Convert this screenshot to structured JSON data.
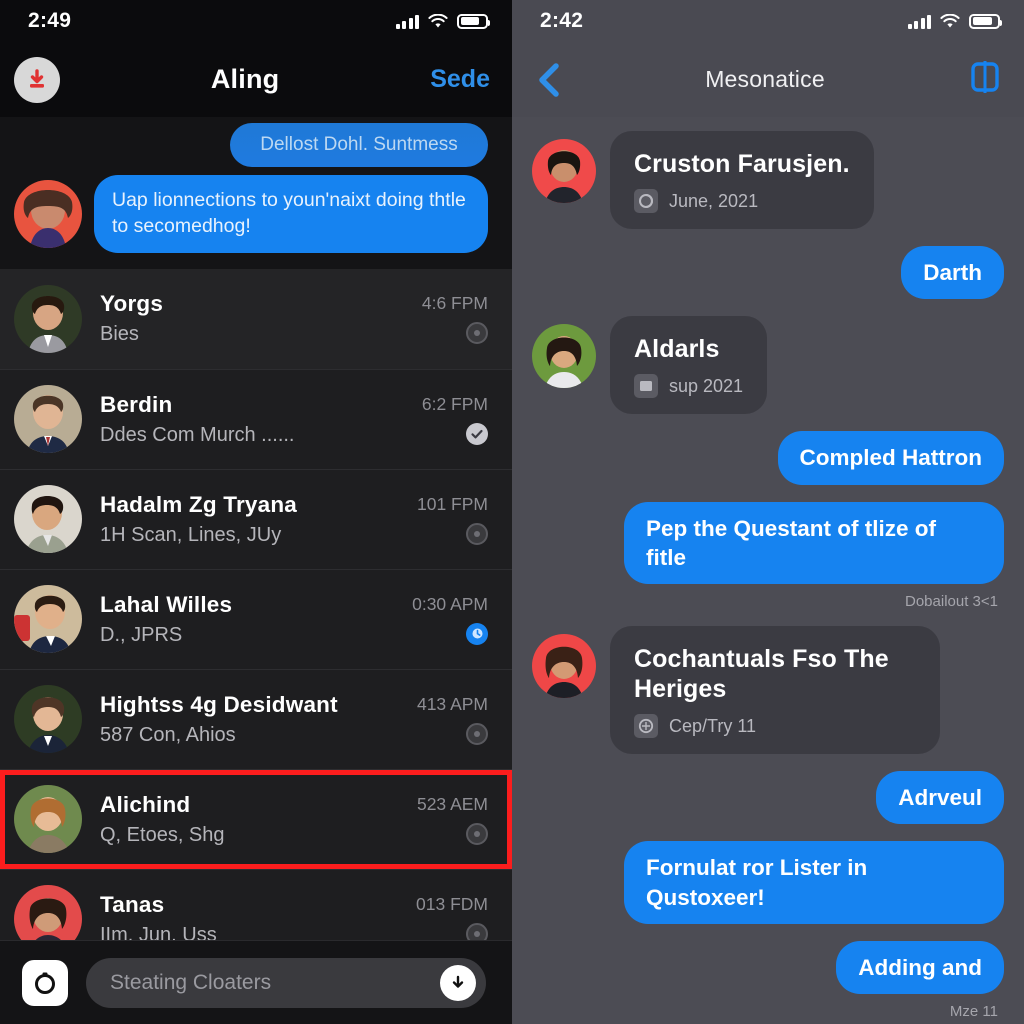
{
  "left": {
    "status": {
      "time": "2:49",
      "signal_icon": "cellular-bars-icon",
      "wifi_icon": "wifi-icon",
      "battery_icon": "battery-icon"
    },
    "nav": {
      "download_icon": "download-icon",
      "title": "Aling",
      "action_label": "Sede"
    },
    "preview": {
      "top_bubble": "Dellost Dohl. Suntmess",
      "main_bubble": "Uap lionnections to youn'naixt doing thtle to secomedhog!"
    },
    "rows": [
      {
        "name": "Yorgs",
        "sub": "Bies",
        "time": "4:6 FPM",
        "status": "pending"
      },
      {
        "name": "Berdin",
        "sub": "Ddes Com Murch ......",
        "time": "6:2 FPM",
        "status": "read"
      },
      {
        "name": "Hadalm Zg Tryana",
        "sub": "1H Scan, Lines, JUy",
        "time": "101 FPM",
        "status": "pending"
      },
      {
        "name": "Lahal Willes",
        "sub": "D., JPRS",
        "time": "0:30 APM",
        "status": "blue"
      },
      {
        "name": "Hightss 4g Desidwant",
        "sub": "587 Con, Ahios",
        "time": "413 APM",
        "status": "pending"
      },
      {
        "name": "Alichind",
        "sub": "Q, Etoes, Shg",
        "time": "523 AEM",
        "status": "pending",
        "selected": true
      },
      {
        "name": "Tanas",
        "sub": "IIm. Jun, Uss",
        "time": "013 FDM",
        "status": "pending"
      }
    ],
    "bottom": {
      "camera_icon": "camera-shutter-icon",
      "search_placeholder": "Steating Cloaters",
      "download_icon": "download-circle-icon"
    }
  },
  "right": {
    "status": {
      "time": "2:42",
      "signal_icon": "cellular-bars-icon",
      "wifi_icon": "wifi-icon",
      "battery_icon": "battery-icon"
    },
    "nav": {
      "back_icon": "back-chevron-icon",
      "title": "Mesonatice",
      "action_icon": "book-compose-icon"
    },
    "messages": [
      {
        "type": "card",
        "side": "in",
        "title": "Cruston Farusjen.",
        "meta": "June, 2021",
        "meta_icon": "media-thumb-icon"
      },
      {
        "type": "bubble",
        "side": "out",
        "text": "Darth"
      },
      {
        "type": "card",
        "side": "in",
        "title": "Aldarls",
        "meta": "sup 2021",
        "meta_icon": "media-thumb-icon"
      },
      {
        "type": "bubble",
        "side": "out",
        "text": "Compled Hattron"
      },
      {
        "type": "bubble",
        "side": "out",
        "text": "Pep the Questant of tlize of fitle",
        "stamp": "Dobailout 3<1"
      },
      {
        "type": "card",
        "side": "in",
        "title": "Cochantuals Fso The Heriges",
        "meta": "Cep/Try 11",
        "meta_icon": "media-thumb-icon"
      },
      {
        "type": "bubble",
        "side": "out",
        "text": "Adrveul"
      },
      {
        "type": "bubble",
        "side": "out",
        "text": "Fornulat ror Lister in Qustoxeer!"
      },
      {
        "type": "bubble",
        "side": "out",
        "text": "Adding and",
        "stamp": "Mze 11"
      }
    ]
  },
  "colors": {
    "accent_blue": "#1683f0",
    "nav_link": "#2f8fe8",
    "highlight_red": "#fc1d1d",
    "left_bg": "#1e1e20",
    "right_bg": "#4c4c54"
  }
}
